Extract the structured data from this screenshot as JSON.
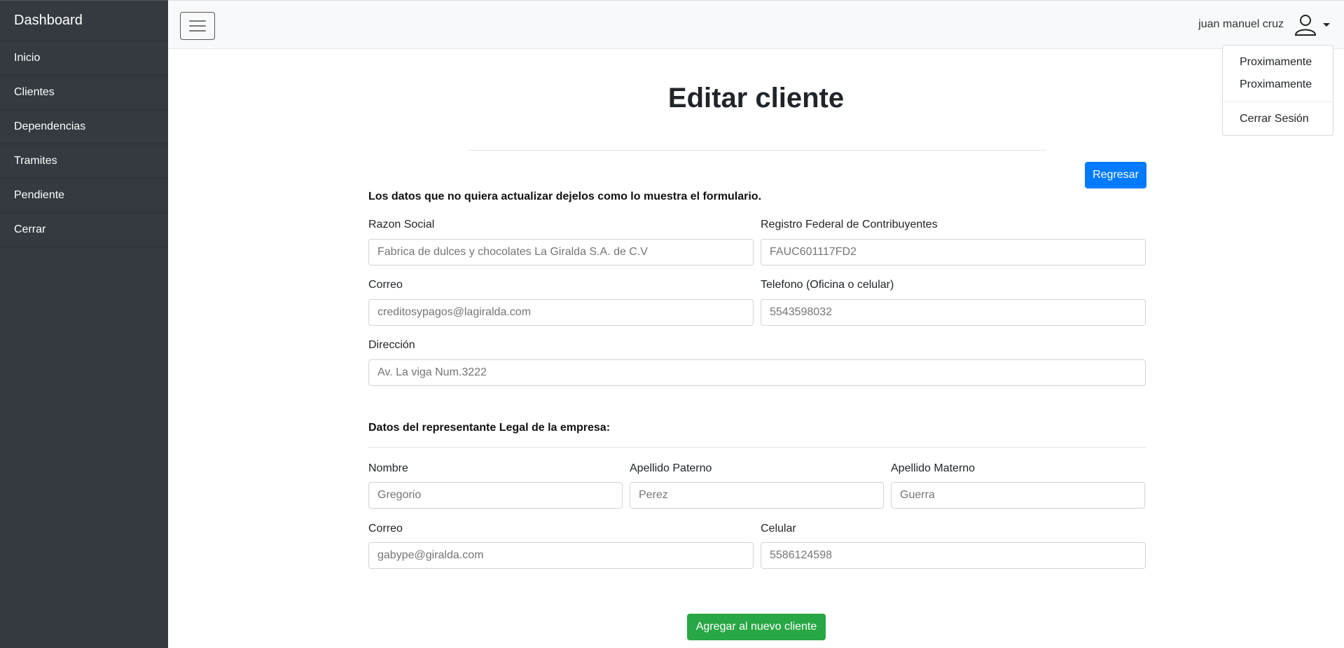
{
  "sidebar": {
    "brand": "Dashboard",
    "items": [
      {
        "label": "Inicio"
      },
      {
        "label": "Clientes"
      },
      {
        "label": "Dependencias"
      },
      {
        "label": "Tramites"
      },
      {
        "label": "Pendiente"
      },
      {
        "label": "Cerrar"
      }
    ]
  },
  "navbar": {
    "toggler_icon": "hamburger-icon",
    "user_name": "juan manuel cruz",
    "user_icon": "user-icon"
  },
  "dropdown": {
    "items": [
      "Proximamente",
      "Proximamente"
    ],
    "logout": "Cerrar Sesión"
  },
  "page": {
    "title": "Editar cliente",
    "back_button": "Regresar",
    "note": "Los datos que no quiera actualizar dejelos como lo muestra el formulario."
  },
  "company": {
    "razon_social": {
      "label": "Razon Social",
      "placeholder": "Fabrica de dulces y chocolates La Giralda S.A. de C.V"
    },
    "rfc": {
      "label": "Registro Federal de Contribuyentes",
      "placeholder": "FAUC601117FD2"
    },
    "correo": {
      "label": "Correo",
      "placeholder": "creditosypagos@lagiralda.com"
    },
    "telefono": {
      "label": "Telefono (Oficina o celular)",
      "placeholder": "5543598032"
    },
    "direccion": {
      "label": "Dirección",
      "placeholder": "Av. La viga Num.3222"
    }
  },
  "representative": {
    "heading": "Datos del representante Legal de la empresa:",
    "nombre": {
      "label": "Nombre",
      "placeholder": "Gregorio"
    },
    "apellido_paterno": {
      "label": "Apellido Paterno",
      "placeholder": "Perez"
    },
    "apellido_materno": {
      "label": "Apellido Materno",
      "placeholder": "Guerra"
    },
    "correo": {
      "label": "Correo",
      "placeholder": "gabype@giralda.com"
    },
    "celular": {
      "label": "Celular",
      "placeholder": "5586124598"
    }
  },
  "submit_button": "Agregar al nuevo cliente",
  "colors": {
    "sidebar_bg": "#343a40",
    "primary": "#007bff",
    "success": "#28a745"
  }
}
